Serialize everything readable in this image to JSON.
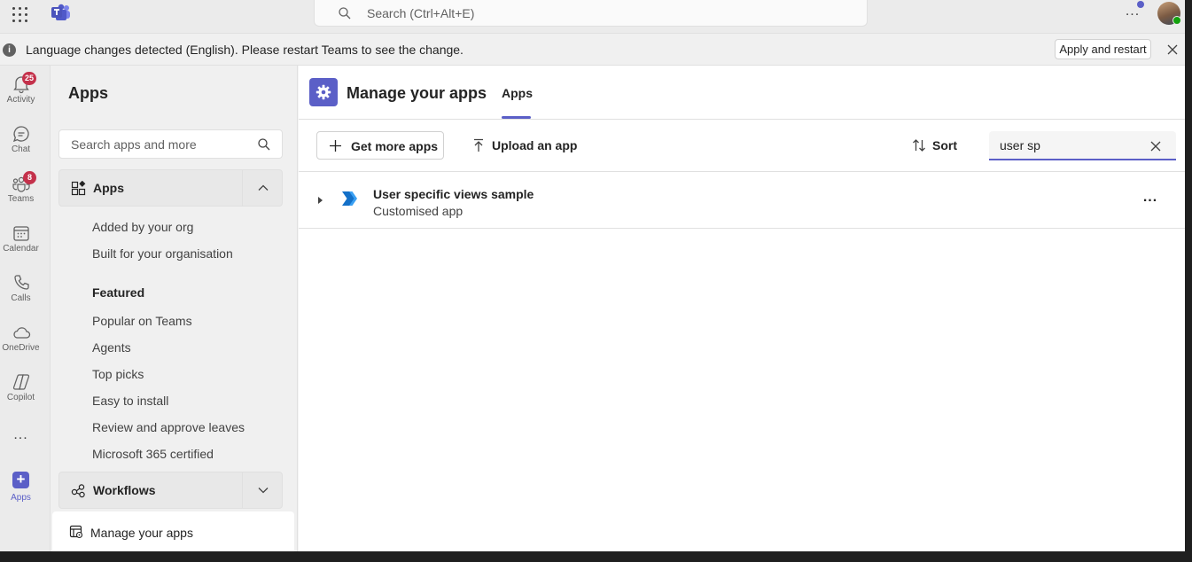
{
  "topbar": {
    "search_placeholder": "Search (Ctrl+Alt+E)",
    "more": "..."
  },
  "notice": {
    "message": "Language changes detected (English). Please restart Teams to see the change.",
    "button": "Apply and restart"
  },
  "rail": {
    "items": [
      {
        "label": "Activity",
        "icon": "bell-icon",
        "badge": "25"
      },
      {
        "label": "Chat",
        "icon": "chat-icon",
        "badge": ""
      },
      {
        "label": "Teams",
        "icon": "teams-icon",
        "badge": "8"
      },
      {
        "label": "Calendar",
        "icon": "calendar-icon",
        "badge": ""
      },
      {
        "label": "Calls",
        "icon": "phone-icon",
        "badge": ""
      },
      {
        "label": "OneDrive",
        "icon": "cloud-icon",
        "badge": ""
      },
      {
        "label": "Copilot",
        "icon": "copilot-icon",
        "badge": ""
      },
      {
        "label": "Apps",
        "icon": "apps-icon",
        "badge": ""
      }
    ],
    "more": "..."
  },
  "panel": {
    "title": "Apps",
    "search_placeholder": "Search apps and more",
    "apps_section": "Apps",
    "apps_links": [
      "Added by your org",
      "Built for your organisation"
    ],
    "featured_heading": "Featured",
    "featured_links": [
      "Popular on Teams",
      "Agents",
      "Top picks",
      "Easy to install",
      "Review and approve leaves",
      "Microsoft 365 certified"
    ],
    "workflows_section": "Workflows",
    "manage": "Manage your apps"
  },
  "main": {
    "title": "Manage your apps",
    "tab": "Apps",
    "get_more": "Get more apps",
    "upload": "Upload an app",
    "sort": "Sort",
    "filter_value": "user sp",
    "app_row": {
      "name": "User specific views sample",
      "type": "Customised app",
      "more": "..."
    }
  },
  "colors": {
    "accent": "#5b5fc7",
    "badge": "#c4314b",
    "presence": "#13a10e"
  }
}
